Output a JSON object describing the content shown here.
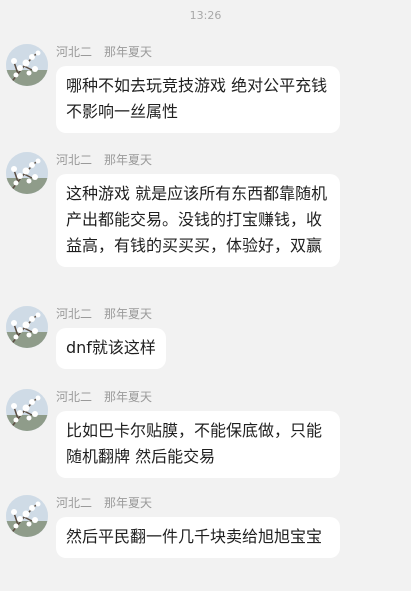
{
  "status_bar": {
    "time": "13:26"
  },
  "colors": {
    "background": "#f2f2f2",
    "bubble": "#ffffff",
    "meta_text": "#9a9a9a",
    "message_text": "#1f1f1f"
  },
  "messages": [
    {
      "sender": "河北二",
      "tag": "那年夏天",
      "avatar_icon": "white-blossom-branch-avatar-icon",
      "text": "哪种不如去玩竞技游戏 绝对公平充钱不影响一丝属性"
    },
    {
      "sender": "河北二",
      "tag": "那年夏天",
      "avatar_icon": "white-blossom-branch-avatar-icon",
      "text": "这种游戏 就是应该所有东西都靠随机产出都能交易。没钱的打宝赚钱，收益高，有钱的买买买，体验好，双赢"
    },
    {
      "sender": "河北二",
      "tag": "那年夏天",
      "avatar_icon": "white-blossom-branch-avatar-icon",
      "text": "dnf就该这样"
    },
    {
      "sender": "河北二",
      "tag": "那年夏天",
      "avatar_icon": "white-blossom-branch-avatar-icon",
      "text": "比如巴卡尔贴膜，不能保底做，只能随机翻牌 然后能交易"
    },
    {
      "sender": "河北二",
      "tag": "那年夏天",
      "avatar_icon": "white-blossom-branch-avatar-icon",
      "text": "然后平民翻一件几千块卖给旭旭宝宝"
    }
  ]
}
